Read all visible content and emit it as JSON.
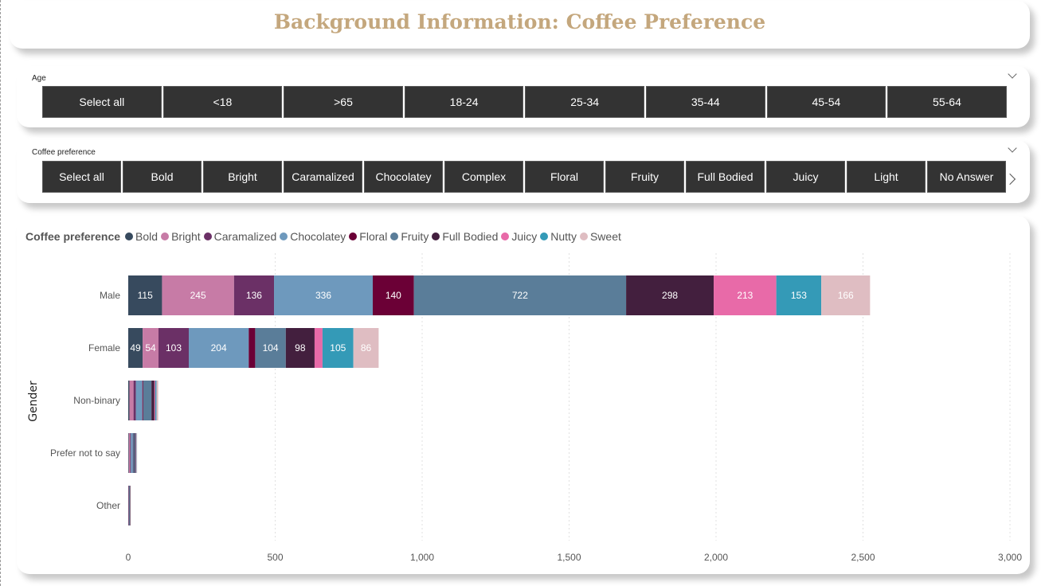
{
  "header": {
    "title": "Background Information: Coffee Preference"
  },
  "age_slicer": {
    "label": "Age",
    "options": [
      "Select all",
      "<18",
      ">65",
      "18-24",
      "25-34",
      "35-44",
      "45-54",
      "55-64"
    ]
  },
  "pref_slicer": {
    "label": "Coffee preference",
    "options": [
      "Select all",
      "Bold",
      "Bright",
      "Caramalized",
      "Chocolatey",
      "Complex",
      "Floral",
      "Fruity",
      "Full Bodied",
      "Juicy",
      "Light",
      "No Answer"
    ]
  },
  "chart_data": {
    "type": "bar",
    "orientation": "horizontal",
    "stacked": true,
    "legend_title": "Coffee preference",
    "legend_position": "top-left",
    "ylabel": "Gender",
    "xlabel": "",
    "xlim": [
      0,
      3000
    ],
    "xticks": [
      "0",
      "500",
      "1,000",
      "1,500",
      "2,000",
      "2,500",
      "3,000"
    ],
    "xtick_values": [
      0,
      500,
      1000,
      1500,
      2000,
      2500,
      3000
    ],
    "grid": "vertical dotted",
    "categories": [
      "Male",
      "Female",
      "Non-binary",
      "Prefer not to say",
      "Other"
    ],
    "series": [
      {
        "name": "Bold",
        "color": "#374a5e",
        "values": [
          115,
          49,
          4,
          2,
          1
        ]
      },
      {
        "name": "Bright",
        "color": "#c77ba6",
        "values": [
          245,
          54,
          14,
          4,
          1
        ]
      },
      {
        "name": "Caramalized",
        "color": "#6b3066",
        "values": [
          136,
          103,
          8,
          3,
          1
        ]
      },
      {
        "name": "Chocolatey",
        "color": "#6e99bd",
        "values": [
          336,
          204,
          22,
          7,
          1
        ]
      },
      {
        "name": "Floral",
        "color": "#6b0036",
        "values": [
          140,
          22,
          3,
          1,
          0
        ]
      },
      {
        "name": "Fruity",
        "color": "#5a7d99",
        "values": [
          722,
          104,
          28,
          5,
          1
        ]
      },
      {
        "name": "Full Bodied",
        "color": "#431f3e",
        "values": [
          298,
          98,
          10,
          3,
          1
        ]
      },
      {
        "name": "Juicy",
        "color": "#e86aa8",
        "values": [
          213,
          27,
          3,
          1,
          0
        ]
      },
      {
        "name": "Nutty",
        "color": "#349ab7",
        "values": [
          153,
          105,
          4,
          2,
          0
        ]
      },
      {
        "name": "Sweet",
        "color": "#dfbdc2",
        "values": [
          166,
          86,
          6,
          2,
          0
        ]
      }
    ],
    "data_labels": {
      "Male": [
        "115",
        "245",
        "136",
        "336",
        "140",
        "722",
        "298",
        "213",
        "153",
        "166"
      ],
      "Female": [
        "49",
        "54",
        "103",
        "204",
        "",
        "104",
        "98",
        "",
        "105",
        "86"
      ]
    }
  }
}
